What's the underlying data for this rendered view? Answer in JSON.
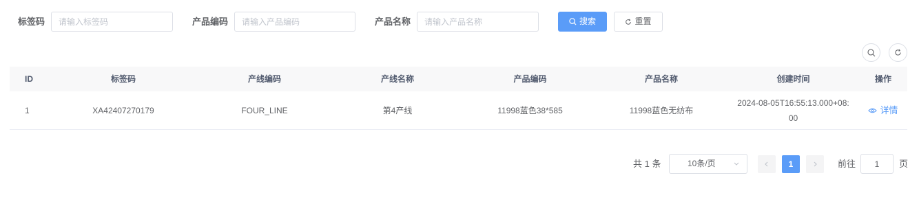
{
  "search": {
    "fields": [
      {
        "label": "标签码",
        "placeholder": "请输入标签码"
      },
      {
        "label": "产品编码",
        "placeholder": "请输入产品编码"
      },
      {
        "label": "产品名称",
        "placeholder": "请输入产品名称"
      }
    ],
    "search_button": "搜索",
    "reset_button": "重置"
  },
  "toolbar": {
    "icons": [
      "search-icon",
      "refresh-icon"
    ]
  },
  "table": {
    "columns": [
      "ID",
      "标签码",
      "产线编码",
      "产线名称",
      "产品编码",
      "产品名称",
      "创建时间",
      "操作"
    ],
    "rows": [
      {
        "id": "1",
        "tag_code": "XA42407270179",
        "line_code": "FOUR_LINE",
        "line_name": "第4产线",
        "product_code": "11998蓝色38*585",
        "product_name": "11998蓝色无纺布",
        "created_at": "2024-08-05T16:55:13.000+08:00",
        "action": "详情"
      }
    ]
  },
  "pagination": {
    "total_text": "共 1 条",
    "page_size": "10条/页",
    "current_page": "1",
    "jump_label": "前往",
    "jump_value": "1",
    "jump_unit": "页"
  },
  "colors": {
    "primary": "#5a9cf8",
    "header_bg": "#f8f8f9",
    "border": "#dcdfe6"
  }
}
